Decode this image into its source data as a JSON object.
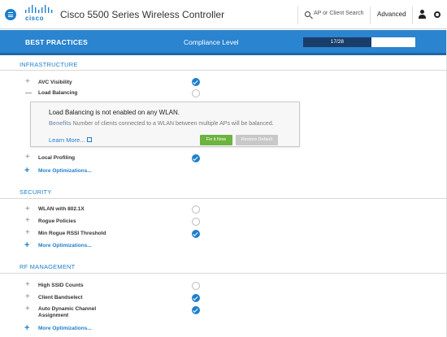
{
  "header": {
    "brand": "cisco",
    "title": "Cisco 5500 Series Wireless Controller",
    "search_placeholder": "AP or Client Search",
    "advanced_label": "Advanced",
    "icons": [
      "menu-icon",
      "search-icon",
      "user-icon",
      "gear-icon"
    ]
  },
  "banner": {
    "title": "BEST PRACTICES",
    "compliance_label": "Compliance Level",
    "progress_text": "17/28",
    "progress_fraction": 0.607,
    "color": "#2a84cf"
  },
  "sections": {
    "infrastructure": {
      "title": "INFRASTRUCTURE",
      "items": [
        {
          "label": "AVC Visibility",
          "status": "checked"
        },
        {
          "label": "Load Balancing",
          "status": "unchecked",
          "expanded": true
        },
        {
          "label": "Local Profiling",
          "status": "checked"
        }
      ],
      "more": "More Optimizations..."
    },
    "security": {
      "title": "SECURITY",
      "items": [
        {
          "label": "WLAN with 802.1X",
          "status": "unchecked"
        },
        {
          "label": "Rogue Policies",
          "status": "unchecked"
        },
        {
          "label": "Min Rogue RSSI Threshold",
          "status": "checked"
        }
      ],
      "more": "More Optimizations..."
    },
    "rf_management": {
      "title": "RF MANAGEMENT",
      "items": [
        {
          "label": "High SSID Counts",
          "status": "unchecked"
        },
        {
          "label": "Client Bandselect",
          "status": "checked"
        },
        {
          "label": "Auto Dynamic Channel",
          "label2": "Assignment",
          "status": "checked"
        }
      ],
      "more": "More Optimizations..."
    }
  },
  "panel": {
    "title": "Load Balancing is not enabled on any WLAN.",
    "benefits_label": "Benefits",
    "benefits_text": "Number of clients connected to a WLAN between multiple APs will be balanced.",
    "learn_more": "Learn More...",
    "fix_button": "Fix it Now",
    "restore_button": "Restore Default"
  },
  "colors": {
    "accent": "#1e7fcb",
    "fix_button": "#6cb33f",
    "restore_button": "#c8c8c8",
    "progress_fill": "#1a3e6b"
  }
}
